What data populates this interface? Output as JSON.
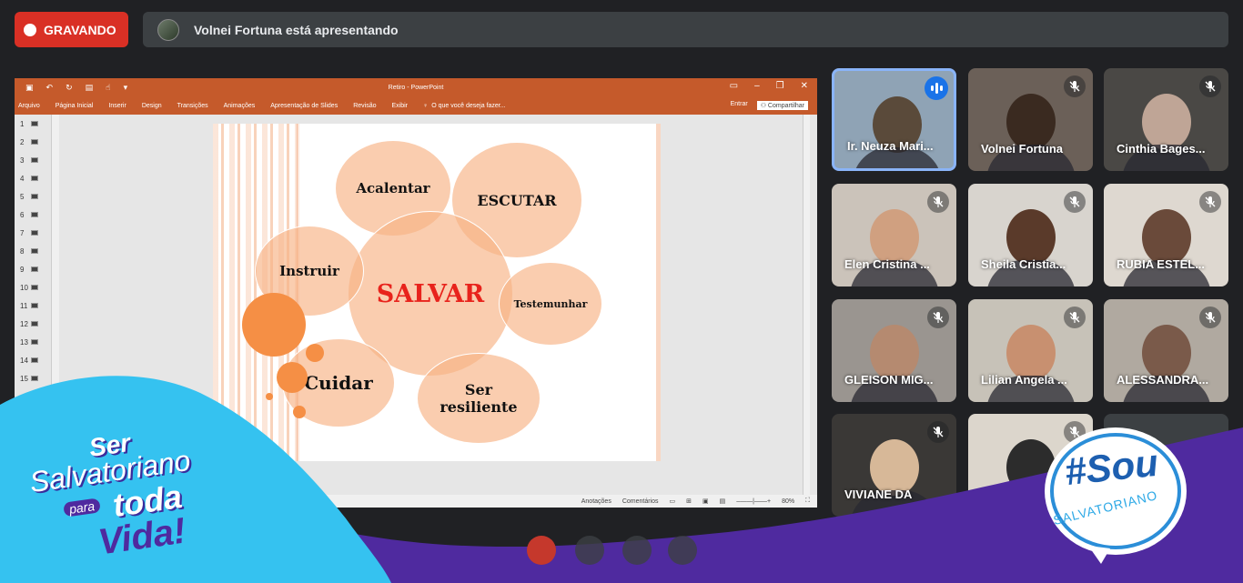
{
  "recording": {
    "label": "GRAVANDO"
  },
  "presenter_bar": {
    "text": "Volnei Fortuna está apresentando"
  },
  "ppt": {
    "title": "Retiro - PowerPoint",
    "menu": [
      "Arquivo",
      "Página Inicial",
      "Inserir",
      "Design",
      "Transições",
      "Animações",
      "Apresentação de Slides",
      "Revisão",
      "Exibir"
    ],
    "search_placeholder": "O que você deseja fazer...",
    "sign_in": "Entrar",
    "share": "Compartilhar",
    "slide_numbers": [
      "1",
      "2",
      "3",
      "4",
      "5",
      "6",
      "7",
      "8",
      "9",
      "10",
      "11",
      "12",
      "13",
      "14",
      "15"
    ],
    "status_notes": "Anotações",
    "status_comments": "Comentários",
    "zoom": "80%"
  },
  "slide": {
    "center": "SALVAR",
    "acalentar": "Acalentar",
    "escutar": "ESCUTAR",
    "instruir": "Instruir",
    "testemunhar": "Testemunhar",
    "cuidar": "Cuidar",
    "ser_resiliente_1": "Ser",
    "ser_resiliente_2": "resiliente",
    "center_color": "#e8231c"
  },
  "participants": [
    {
      "name": "Ir. Neuza Mari...",
      "speaking": true
    },
    {
      "name": "Volnei Fortuna",
      "muted": true
    },
    {
      "name": "Cinthia Bages...",
      "muted": true
    },
    {
      "name": "Elen Cristina ...",
      "muted": true
    },
    {
      "name": "Sheila Cristia...",
      "muted": true
    },
    {
      "name": "RUBIA ESTEL...",
      "muted": true
    },
    {
      "name": "GLEISON MIG...",
      "muted": true
    },
    {
      "name": "Lilian Angela ...",
      "muted": true
    },
    {
      "name": "ALESSANDRA...",
      "muted": true
    },
    {
      "name": "VIVIANE DA",
      "muted": true
    },
    {
      "name": "",
      "muted": true
    }
  ],
  "branding": {
    "left_line1": "Ser",
    "left_line2": "Salvatoriano",
    "left_line3a": "para",
    "left_line3b": "toda",
    "left_line4": "Vida!",
    "right_line1": "#Sou",
    "right_line2": "SALVATORIANO"
  },
  "colors": {
    "record_red": "#d93025",
    "ppt_orange": "#c55a2b",
    "accent_blue": "#1a73e8",
    "overlay_purple": "#5b2fae",
    "overlay_cyan": "#2ec4f1"
  }
}
